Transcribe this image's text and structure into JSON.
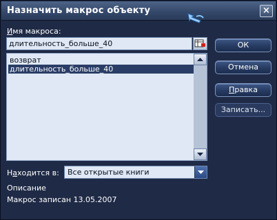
{
  "window": {
    "title": "Назначить макрос объекту",
    "close_glyph": "×"
  },
  "macro_name": {
    "label_prefix": "И",
    "label_rest": "мя макроса:",
    "value": "длительность_больше_40"
  },
  "macro_list": {
    "items": [
      "возврат",
      "длительность_больше_40"
    ],
    "selected_index": 1
  },
  "buttons": {
    "ok": "ОК",
    "cancel": "Отмена",
    "edit_prefix": "П",
    "edit_rest": "равка",
    "record": "Записать..."
  },
  "location": {
    "label_start": "Н",
    "label_middle": "а",
    "label_end": "ходится в:",
    "value": "Все открытые книги"
  },
  "description": {
    "heading": "Описание",
    "text": "Макрос записан 13.05.2007"
  },
  "icons": [
    "close-icon",
    "help-cursor-icon",
    "edit-reference-icon",
    "scroll-up-icon",
    "scroll-down-icon",
    "dropdown-arrow-icon"
  ],
  "colors": {
    "window_bg": "#1f2a46",
    "titlebar": "#35496b",
    "selection": "#2a3d66",
    "field_bg": "#dfe8f4"
  }
}
